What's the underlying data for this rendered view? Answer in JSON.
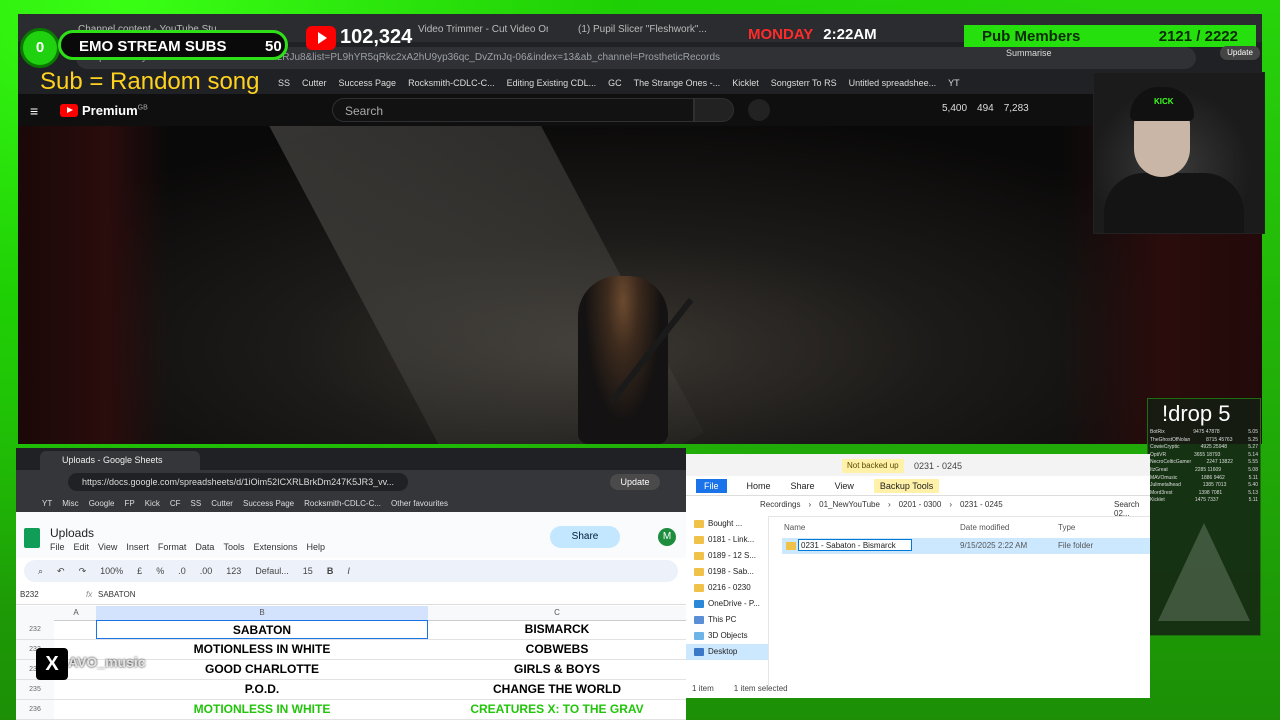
{
  "overlay": {
    "badge_value": "0",
    "subs_label": "EMO STREAM SUBS",
    "subs_count": "50",
    "yt_subscriber_count": "102,324",
    "sub_random": "Sub = Random song",
    "day": "MONDAY",
    "time": "2:22AM",
    "pub_members_label": "Pub Members",
    "pub_members_count": "2121 / 2222",
    "x_handle": "AVO_music",
    "drop_title": "!drop 5"
  },
  "browser": {
    "tabs": [
      "Channel content - YouTube Stu...",
      "Video Trimmer - Cut Video Onlin...",
      "(1) Pupil Slicer \"Fleshwork\"..."
    ],
    "address": "https://www.youtube.com/watch?v=ZD26oIzRJu8&list=PL9hYR5qRkc2xA2hU9yp36qc_DvZmJq-06&index=13&ab_channel=ProstheticRecords",
    "bookmarks": [
      "SS",
      "Cutter",
      "Success Page",
      "Rocksmith-CDLC-C...",
      "Editing Existing CDL...",
      "GC",
      "The Strange Ones -...",
      "Kicklet",
      "Songsterr To RS",
      "Untitled spreadshee...",
      "YT"
    ],
    "summarise": "Summarise",
    "update": "Update"
  },
  "youtube": {
    "menu_icon": "≡",
    "premium": "Premium",
    "premium_region": "GB",
    "search_placeholder": "Search",
    "stats": [
      "5,400",
      "494",
      "7,283"
    ]
  },
  "drop_board": {
    "rows": [
      [
        "BotRix",
        "9475 47878",
        "5.05"
      ],
      [
        "TheGhostOfNolan",
        "8715 45763",
        "5.25"
      ],
      [
        "CowieCryptic",
        "4925 25948",
        "5.27"
      ],
      [
        "OptiVR",
        "3655 18793",
        "5.14"
      ],
      [
        "NecroCelticGamer",
        "2247 13822",
        "5.55"
      ],
      [
        "ItzGreat",
        "2285 11609",
        "5.08"
      ],
      [
        "MAVOmusic",
        "1886 9462",
        "5.11"
      ],
      [
        "Julimetalhead",
        "1385 7013",
        "5.40"
      ],
      [
        "Mord3rest",
        "1398 7081",
        "5.13"
      ],
      [
        "Kicklet",
        "1475 7337",
        "5.11"
      ]
    ]
  },
  "sheets": {
    "tab_title": "Uploads - Google Sheets",
    "address": "https://docs.google.com/spreadsheets/d/1iOim52ICXRLBrkDm247K5JR3_vv...",
    "update": "Update",
    "bookmarks": [
      "YT",
      "Misc",
      "Google",
      "FP",
      "Kick",
      "CF",
      "SS",
      "Cutter",
      "Success Page",
      "Rocksmith-CDLC-C...",
      "Other favourites"
    ],
    "doc_title": "Uploads",
    "menus": [
      "File",
      "Edit",
      "View",
      "Insert",
      "Format",
      "Data",
      "Tools",
      "Extensions",
      "Help"
    ],
    "share": "Share",
    "avatar": "M",
    "toolbar": {
      "zoom": "100%",
      "currency": "£",
      "percent": "%",
      "dec_less": ".0",
      "dec_more": ".00",
      "format123": "123",
      "font": "Defaul...",
      "font_size": "15",
      "bold": "B",
      "italic": "I"
    },
    "cell_ref": "B232",
    "formula_value": "SABATON",
    "col_a": "A",
    "col_b": "B",
    "col_c": "C",
    "rows": [
      {
        "num": "232",
        "b": "SABATON",
        "c": "BISMARCK"
      },
      {
        "num": "233",
        "b": "MOTIONLESS IN WHITE",
        "c": "COBWEBS"
      },
      {
        "num": "234",
        "b": "GOOD CHARLOTTE",
        "c": "GIRLS & BOYS"
      },
      {
        "num": "235",
        "b": "P.O.D.",
        "c": "CHANGE THE WORLD"
      },
      {
        "num": "236",
        "b": "MOTIONLESS IN WHITE",
        "c": "CREATURES X: TO THE GRAV"
      }
    ]
  },
  "explorer": {
    "not_backed_up": "Not backed up",
    "title": "0231 - 0245",
    "ribbon": [
      "File",
      "Home",
      "Share",
      "View",
      "Backup Tools"
    ],
    "crumbs": [
      "Recordings",
      "01_NewYouTube",
      "0201 - 0300",
      "0231 - 0245"
    ],
    "search": "Search 02...",
    "sidebar": [
      "Bought ...",
      "0181 - Link...",
      "0189 - 12 S...",
      "0198 - Sab...",
      "0216 - 0230",
      "OneDrive - P...",
      "This PC",
      "3D Objects",
      "Desktop"
    ],
    "col_name": "Name",
    "col_date": "Date modified",
    "col_type": "Type",
    "row_name": "0231 - Sabaton - Bismarck",
    "row_date": "9/15/2025 2:22 AM",
    "row_type": "File folder",
    "status_items": "1 item",
    "status_selected": "1 item selected"
  }
}
